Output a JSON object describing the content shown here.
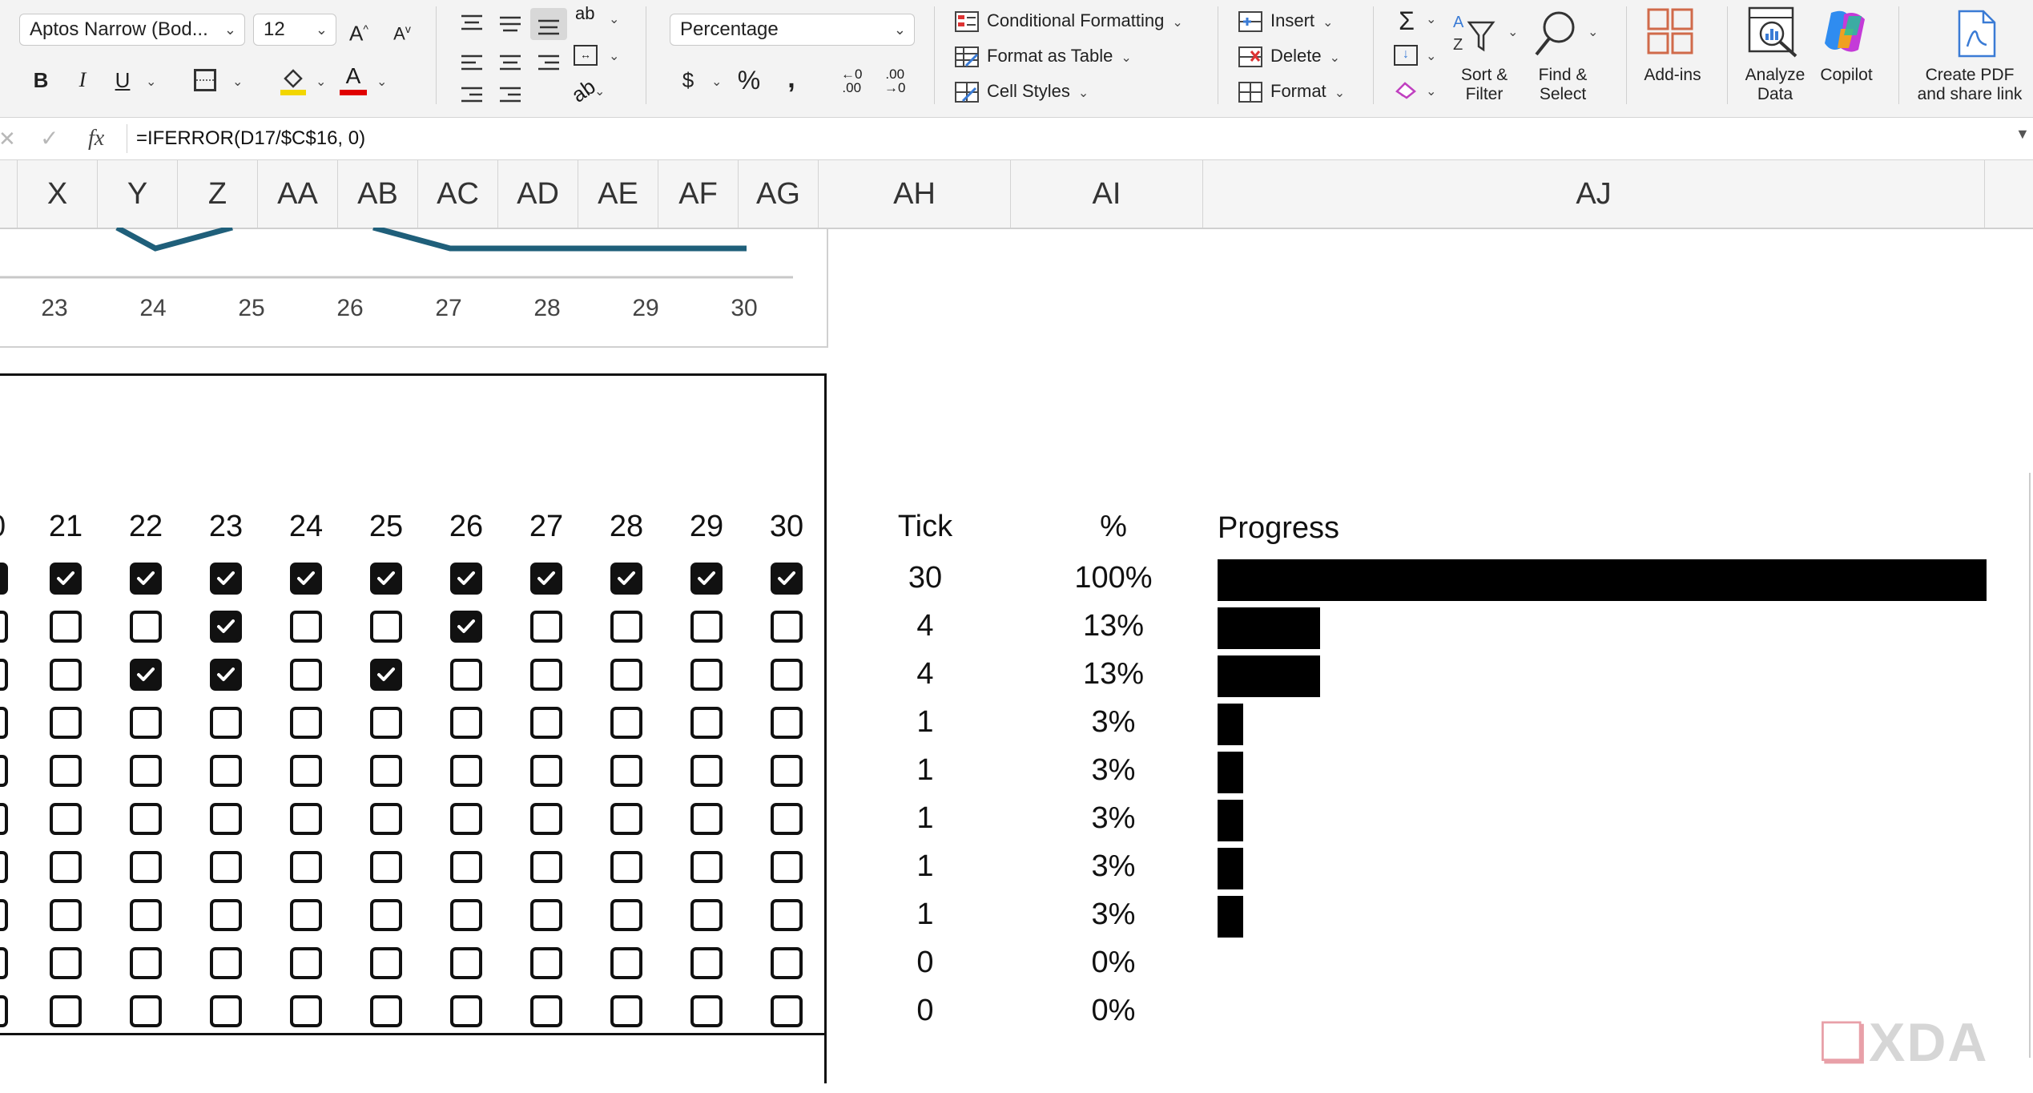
{
  "ribbon": {
    "font_name": "Aptos Narrow (Bod...",
    "font_size": "12",
    "increase_font": "A",
    "decrease_font": "A",
    "bold": "B",
    "italic": "I",
    "underline": "U",
    "number_format": "Percentage",
    "currency": "$",
    "percent": "%",
    "comma": "̓",
    "wrap": "ab",
    "conditional_formatting": "Conditional Formatting",
    "format_as_table": "Format as Table",
    "cell_styles": "Cell Styles",
    "insert": "Insert",
    "delete": "Delete",
    "format": "Format",
    "sigma": "Σ",
    "sort_filter_1": "Sort &",
    "sort_filter_2": "Filter",
    "find_select_1": "Find &",
    "find_select_2": "Select",
    "addins": "Add-ins",
    "analyze_1": "Analyze",
    "analyze_2": "Data",
    "copilot": "Copilot",
    "pdf_1": "Create PDF",
    "pdf_2": "and share link"
  },
  "formula_bar": {
    "cancel": "✕",
    "enter": "✓",
    "fx": "fx",
    "formula": "=IFERROR(D17/$C$16, 0)"
  },
  "columns": [
    "X",
    "Y",
    "Z",
    "AA",
    "AB",
    "AC",
    "AD",
    "AE",
    "AF",
    "AG",
    "AH",
    "AI",
    "AJ"
  ],
  "chart": {
    "x_labels": [
      "23",
      "24",
      "25",
      "26",
      "27",
      "28",
      "29",
      "30"
    ]
  },
  "table": {
    "day_headers": [
      "21",
      "22",
      "23",
      "24",
      "25",
      "26",
      "27",
      "28",
      "29",
      "30"
    ],
    "tick_header": "Tick",
    "pct_header": "%",
    "progress_header": "Progress",
    "rows": [
      {
        "checks": [
          true,
          true,
          true,
          true,
          true,
          true,
          true,
          true,
          true,
          true
        ],
        "tick": "30",
        "pct": "100%",
        "progress": 1.0
      },
      {
        "checks": [
          false,
          false,
          true,
          false,
          false,
          true,
          false,
          false,
          false,
          false
        ],
        "tick": "4",
        "pct": "13%",
        "progress": 0.1333
      },
      {
        "checks": [
          false,
          true,
          true,
          false,
          true,
          false,
          false,
          false,
          false,
          false
        ],
        "tick": "4",
        "pct": "13%",
        "progress": 0.1333
      },
      {
        "checks": [
          false,
          false,
          false,
          false,
          false,
          false,
          false,
          false,
          false,
          false
        ],
        "tick": "1",
        "pct": "3%",
        "progress": 0.0333
      },
      {
        "checks": [
          false,
          false,
          false,
          false,
          false,
          false,
          false,
          false,
          false,
          false
        ],
        "tick": "1",
        "pct": "3%",
        "progress": 0.0333
      },
      {
        "checks": [
          false,
          false,
          false,
          false,
          false,
          false,
          false,
          false,
          false,
          false
        ],
        "tick": "1",
        "pct": "3%",
        "progress": 0.0333
      },
      {
        "checks": [
          false,
          false,
          false,
          false,
          false,
          false,
          false,
          false,
          false,
          false
        ],
        "tick": "1",
        "pct": "3%",
        "progress": 0.0333
      },
      {
        "checks": [
          false,
          false,
          false,
          false,
          false,
          false,
          false,
          false,
          false,
          false
        ],
        "tick": "1",
        "pct": "3%",
        "progress": 0.0333
      },
      {
        "checks": [
          false,
          false,
          false,
          false,
          false,
          false,
          false,
          false,
          false,
          false
        ],
        "tick": "0",
        "pct": "0%",
        "progress": 0
      },
      {
        "checks": [
          false,
          false,
          false,
          false,
          false,
          false,
          false,
          false,
          false,
          false
        ],
        "tick": "0",
        "pct": "0%",
        "progress": 0
      }
    ]
  },
  "watermark": "XDA",
  "colors": {
    "chart_line": "#1f5f7a",
    "fill_accent": "#f2d600",
    "font_accent": "#e00000"
  }
}
